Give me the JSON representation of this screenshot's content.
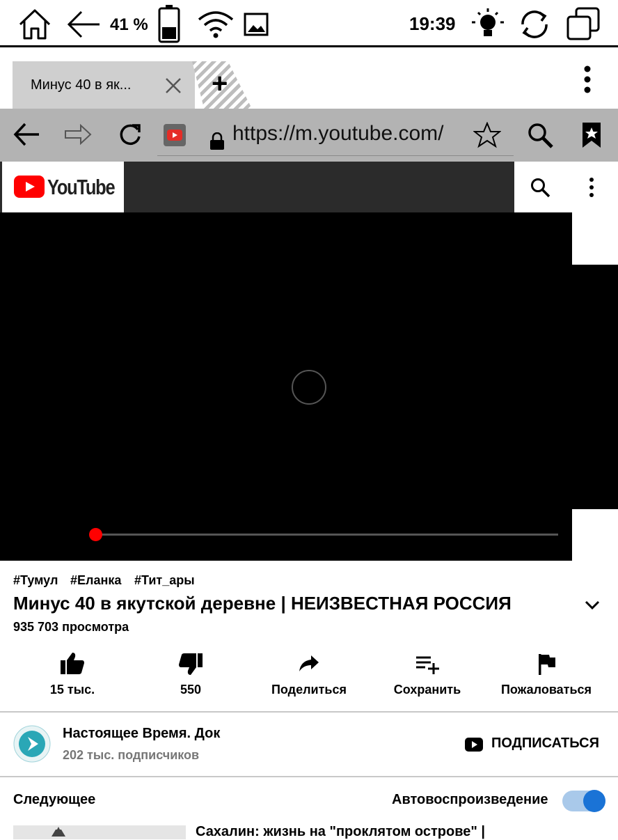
{
  "status_bar": {
    "battery_percent": "41 %",
    "battery_level": 0.41,
    "time": "19:39",
    "icons": [
      "home-icon",
      "back-arrow-icon",
      "battery-icon",
      "wifi-icon",
      "image-icon",
      "frontlight-icon",
      "sync-icon",
      "task-switch-icon"
    ]
  },
  "browser": {
    "tab_title": "Минус 40 в як...",
    "new_tab_glyph": "+",
    "url": "https://m.youtube.com/"
  },
  "youtube": {
    "brand": "YouTube",
    "brand_color": "#ff0000"
  },
  "video": {
    "progress_fraction": 0.0,
    "progress_color": "#ff0000"
  },
  "info": {
    "hashtags": [
      "#Тумул",
      "#Еланка",
      "#Тит_ары"
    ],
    "title": "Минус 40 в якутской деревне | НЕИЗВЕСТНАЯ РОССИЯ",
    "views": "935 703 просмотра",
    "actions": {
      "likes": "15 тыс.",
      "dislikes": "550",
      "share": "Поделиться",
      "save": "Сохранить",
      "report": "Пожаловаться"
    }
  },
  "channel": {
    "name": "Настоящее Время. Док",
    "subscribers": "202 тыс. подписчиков",
    "subscribe": "ПОДПИСАТЬСЯ",
    "avatar_color": "#2aa7b6"
  },
  "up_next": {
    "label": "Следующее",
    "autoplay_label": "Автовоспроизведение",
    "autoplay_on": true,
    "toggle_color": "#1a73d6",
    "next_video_title": "Сахалин: жизнь на \"проклятом острове\" |"
  }
}
